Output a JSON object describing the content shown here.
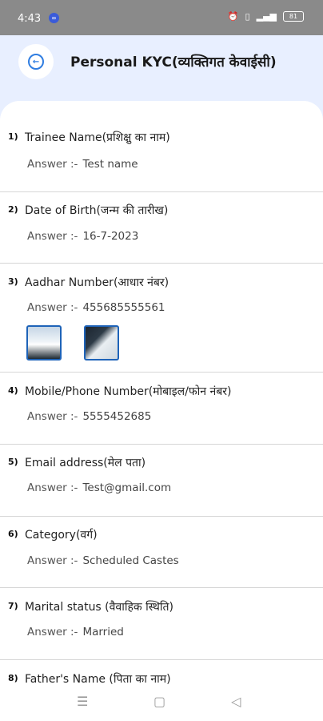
{
  "status": {
    "time": "4:43",
    "app_badge": "∞",
    "battery": "81"
  },
  "header": {
    "title": "Personal KYC(व्यक्तिगत केवाईसी)"
  },
  "answer_prefix": "Answer :-",
  "questions": [
    {
      "num": "1)",
      "q": "Trainee Name(प्रशिक्षु का नाम)",
      "a": "Test name"
    },
    {
      "num": "2)",
      "q": "Date of Birth(जन्म की तारीख)",
      "a": "16-7-2023"
    },
    {
      "num": "3)",
      "q": "Aadhar Number(आधार नंबर)",
      "a": "455685555561"
    },
    {
      "num": "4)",
      "q": "Mobile/Phone Number(मोबाइल/फोन नंबर)",
      "a": "5555452685"
    },
    {
      "num": "5)",
      "q": "Email address(मेल पता)",
      "a": "Test@gmail.com"
    },
    {
      "num": "6)",
      "q": "Category(वर्ग)",
      "a": "Scheduled Castes"
    },
    {
      "num": "7)",
      "q": "Marital status (वैवाहिक स्थिति)",
      "a": "Married"
    },
    {
      "num": "8)",
      "q": "Father's Name (पिता का नाम)",
      "a": ""
    }
  ]
}
